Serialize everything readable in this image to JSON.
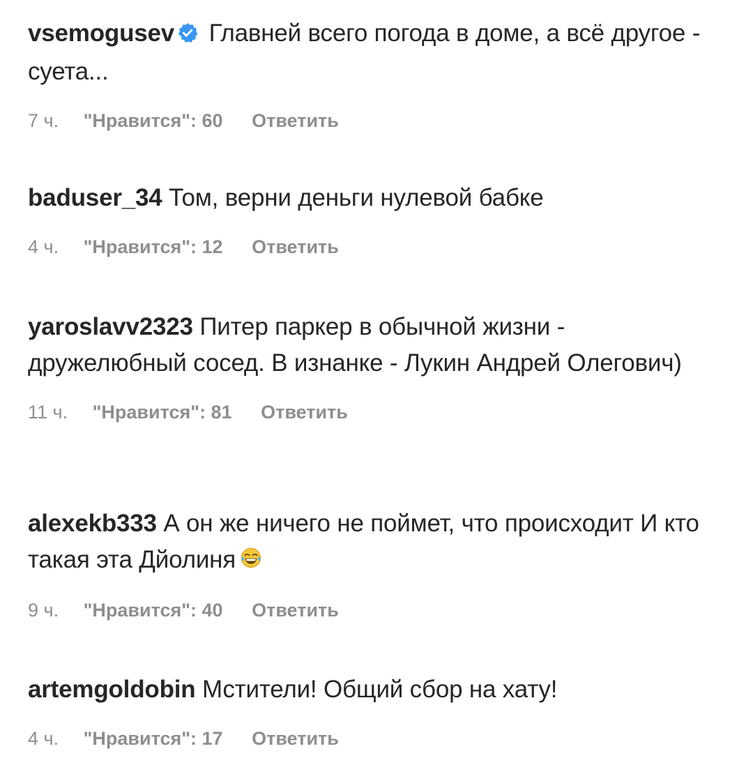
{
  "reply_label": "Ответить",
  "comments": [
    {
      "username": "vsemogusev",
      "verified": true,
      "text": "Главней всего погода в доме, а всё другое - суета...",
      "time": "7 ч.",
      "likes": "\"Нравится\": 60"
    },
    {
      "username": "baduser_34",
      "verified": false,
      "text": "Том, верни деньги нулевой бабке",
      "time": "4 ч.",
      "likes": "\"Нравится\": 12"
    },
    {
      "username": "yaroslavv2323",
      "verified": false,
      "text": "Питер паркер в обычной жизни - дружелюбный сосед. В изнанке - Лукин Андрей Олегович)",
      "time": "11 ч.",
      "likes": "\"Нравится\": 81"
    },
    {
      "username": "alexekb333",
      "verified": false,
      "text": "А он же ничего не поймет, что происходит И кто такая эта Дйолиня",
      "emoji": "face-with-tears-of-joy-icon",
      "time": "9 ч.",
      "likes": "\"Нравится\": 40"
    },
    {
      "username": "artemgoldobin",
      "verified": false,
      "text": "Мстители! Общий сбор на хату!",
      "time": "4 ч.",
      "likes": "\"Нравится\": 17"
    }
  ],
  "colors": {
    "text": "#262626",
    "meta": "#8e8e8e",
    "verified_badge": "#3897f0"
  }
}
